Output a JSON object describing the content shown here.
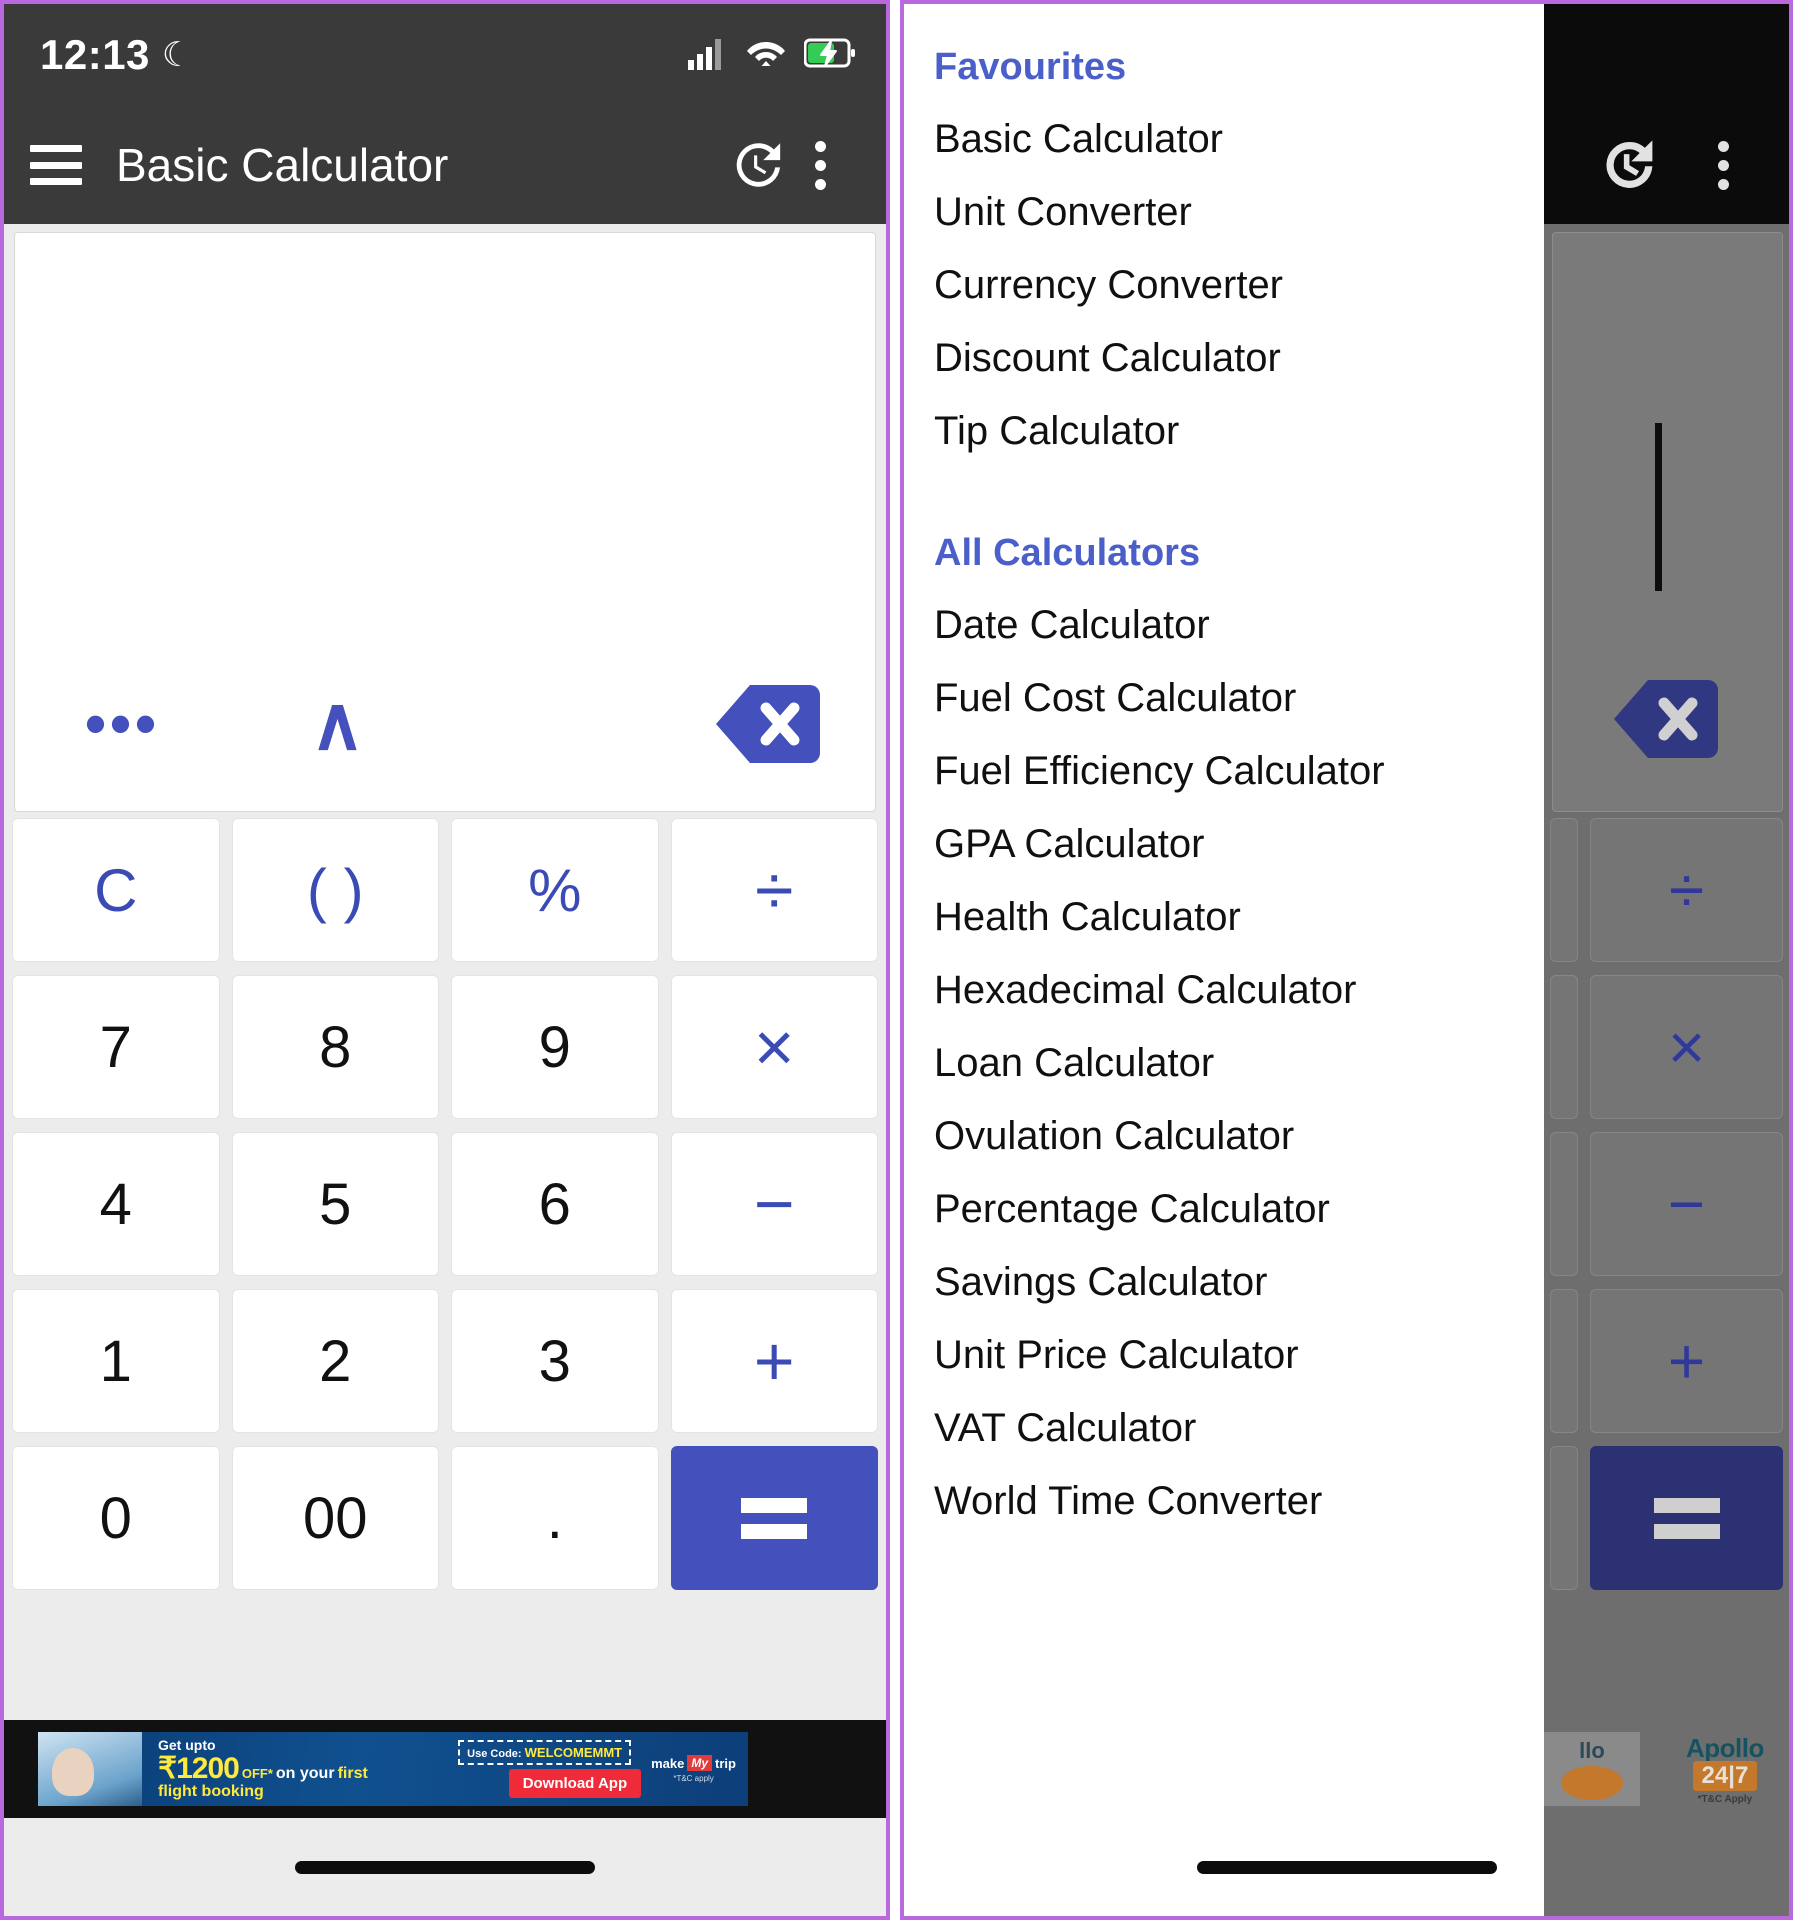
{
  "statusbar": {
    "time": "12:13",
    "moon_icon": "crescent-moon-icon",
    "signal_icon": "cellular-signal-icon",
    "wifi_icon": "wifi-icon",
    "battery_icon": "battery-charging-icon"
  },
  "appbar": {
    "menu_icon": "hamburger-menu-icon",
    "title": "Basic Calculator",
    "history_icon": "history-clock-icon",
    "overflow_icon": "kebab-menu-icon"
  },
  "display": {
    "value": "",
    "more_label": "•••",
    "power_label": "∧",
    "backspace_icon": "backspace-icon"
  },
  "keypad": {
    "rows": [
      [
        {
          "label": "C",
          "kind": "op"
        },
        {
          "label": "( )",
          "kind": "op"
        },
        {
          "label": "%",
          "kind": "op"
        },
        {
          "label": "÷",
          "kind": "op"
        }
      ],
      [
        {
          "label": "7",
          "kind": "num"
        },
        {
          "label": "8",
          "kind": "num"
        },
        {
          "label": "9",
          "kind": "num"
        },
        {
          "label": "×",
          "kind": "op"
        }
      ],
      [
        {
          "label": "4",
          "kind": "num"
        },
        {
          "label": "5",
          "kind": "num"
        },
        {
          "label": "6",
          "kind": "num"
        },
        {
          "label": "−",
          "kind": "op"
        }
      ],
      [
        {
          "label": "1",
          "kind": "num"
        },
        {
          "label": "2",
          "kind": "num"
        },
        {
          "label": "3",
          "kind": "num"
        },
        {
          "label": "+",
          "kind": "op"
        }
      ],
      [
        {
          "label": "0",
          "kind": "num"
        },
        {
          "label": "00",
          "kind": "num"
        },
        {
          "label": ".",
          "kind": "num"
        },
        {
          "label": "=",
          "kind": "equals"
        }
      ]
    ]
  },
  "ad": {
    "headline": "Get upto",
    "amount": "₹1200",
    "off": "OFF*",
    "on_text": "on your",
    "first": "first",
    "flight_booking": "flight booking",
    "code_label": "Use Code:",
    "code_value": "WELCOMEMMT",
    "cta": "Download App",
    "brand_make": "make",
    "brand_mmt": "My",
    "brand_trip": "trip",
    "terms": "*T&C apply"
  },
  "drawer": {
    "favourites_title": "Favourites",
    "favourites": [
      "Basic Calculator",
      "Unit Converter",
      "Currency Converter",
      "Discount Calculator",
      "Tip Calculator"
    ],
    "all_title": "All Calculators",
    "all": [
      "Date Calculator",
      "Fuel Cost Calculator",
      "Fuel Efficiency Calculator",
      "GPA Calculator",
      "Health Calculator",
      "Hexadecimal Calculator",
      "Loan Calculator",
      "Ovulation Calculator",
      "Percentage Calculator",
      "Savings Calculator",
      "Unit Price Calculator",
      "VAT Calculator",
      "World Time Converter"
    ]
  },
  "background_ad": {
    "brand": "Apollo",
    "badge": "24|7",
    "terms": "*T&C Apply"
  },
  "navigation": {
    "gesture_pill": "home-gesture-pill"
  },
  "colors": {
    "accent_blue": "#4450bb",
    "section_heading_blue": "#4a5fc9",
    "appbar_dark": "#3a3a3a",
    "frame_purple": "#b968dd",
    "battery_green": "#33cc55"
  }
}
